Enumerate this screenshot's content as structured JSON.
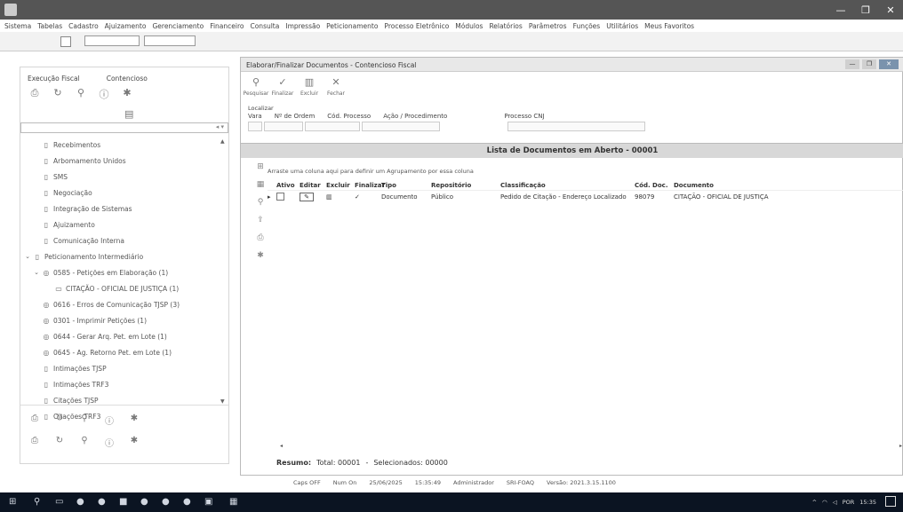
{
  "menu": [
    "Sistema",
    "Tabelas",
    "Cadastro",
    "Ajuizamento",
    "Gerenciamento",
    "Financeiro",
    "Consulta",
    "Impressão",
    "Peticionamento",
    "Processo Eletrônico",
    "Módulos",
    "Relatórios",
    "Parâmetros",
    "Funções",
    "Utilitários",
    "Meus Favoritos"
  ],
  "left_panel": {
    "tabs": [
      "Execução Fiscal",
      "Contencioso"
    ],
    "tree": [
      {
        "label": "Recebimentos",
        "level": 1
      },
      {
        "label": "Arbomamento Unidos",
        "level": 1
      },
      {
        "label": "SMS",
        "level": 1
      },
      {
        "label": "Negociação",
        "level": 1
      },
      {
        "label": "Integração de Sistemas",
        "level": 1
      },
      {
        "label": "Ajuizamento",
        "level": 1
      },
      {
        "label": "Comunicação Interna",
        "level": 1
      },
      {
        "label": "Peticionamento Intermediário",
        "level": 1,
        "expanded": true
      },
      {
        "label": "0585 - Petições em Elaboração (1)",
        "level": 2,
        "expanded": true
      },
      {
        "label": "CITAÇÃO - OFICIAL DE JUSTIÇA (1)",
        "level": 3
      },
      {
        "label": "0616 - Erros de Comunicação TJSP (3)",
        "level": 2
      },
      {
        "label": "0301 - Imprimir Petições (1)",
        "level": 2
      },
      {
        "label": "0644 - Gerar Arq. Pet. em Lote (1)",
        "level": 2
      },
      {
        "label": "0645 - Ag. Retorno Pet. em Lote (1)",
        "level": 2
      },
      {
        "label": "Intimações TJSP",
        "level": 1
      },
      {
        "label": "Intimações TRF3",
        "level": 1
      },
      {
        "label": "Citações TJSP",
        "level": 1
      },
      {
        "label": "Citações TRF3",
        "level": 1
      }
    ]
  },
  "main": {
    "title": "Elaborar/Finalizar Documentos - Contencioso Fiscal",
    "actions": [
      "Pesquisar",
      "Finalizar",
      "Excluir",
      "Fechar"
    ],
    "localizar_label": "Localizar",
    "filter_labels": [
      "Vara",
      "Nº de Ordem",
      "Cód. Processo",
      "Ação / Procedimento",
      "Processo CNJ"
    ],
    "list_title": "Lista de Documentos em Aberto - 00001",
    "group_hint": "Arraste uma coluna aqui para definir um Agrupamento por essa coluna",
    "columns": [
      "Ativo",
      "Editar",
      "Excluir",
      "Finalizar",
      "Tipo",
      "Repositório",
      "Classificação",
      "Cód. Doc.",
      "Documento"
    ],
    "rows": [
      {
        "tipo": "Documento",
        "repositorio": "Público",
        "classificacao": "Pedido de Citação - Endereço Localizado",
        "cod_doc": "98079",
        "documento": "CITAÇÃO - OFICIAL DE JUSTIÇA"
      }
    ],
    "resumo": {
      "label": "Resumo:",
      "total": "Total: 00001",
      "selecionados": "Selecionados: 00000"
    }
  },
  "statusbar": [
    "Caps OFF",
    "Num On",
    "25/06/2025",
    "15:35:49",
    "Administrador",
    "SRI-FOAQ",
    "Versão: 2021.3.15.1100"
  ],
  "taskbar": {
    "tray": [
      "POR",
      "15:35"
    ]
  }
}
